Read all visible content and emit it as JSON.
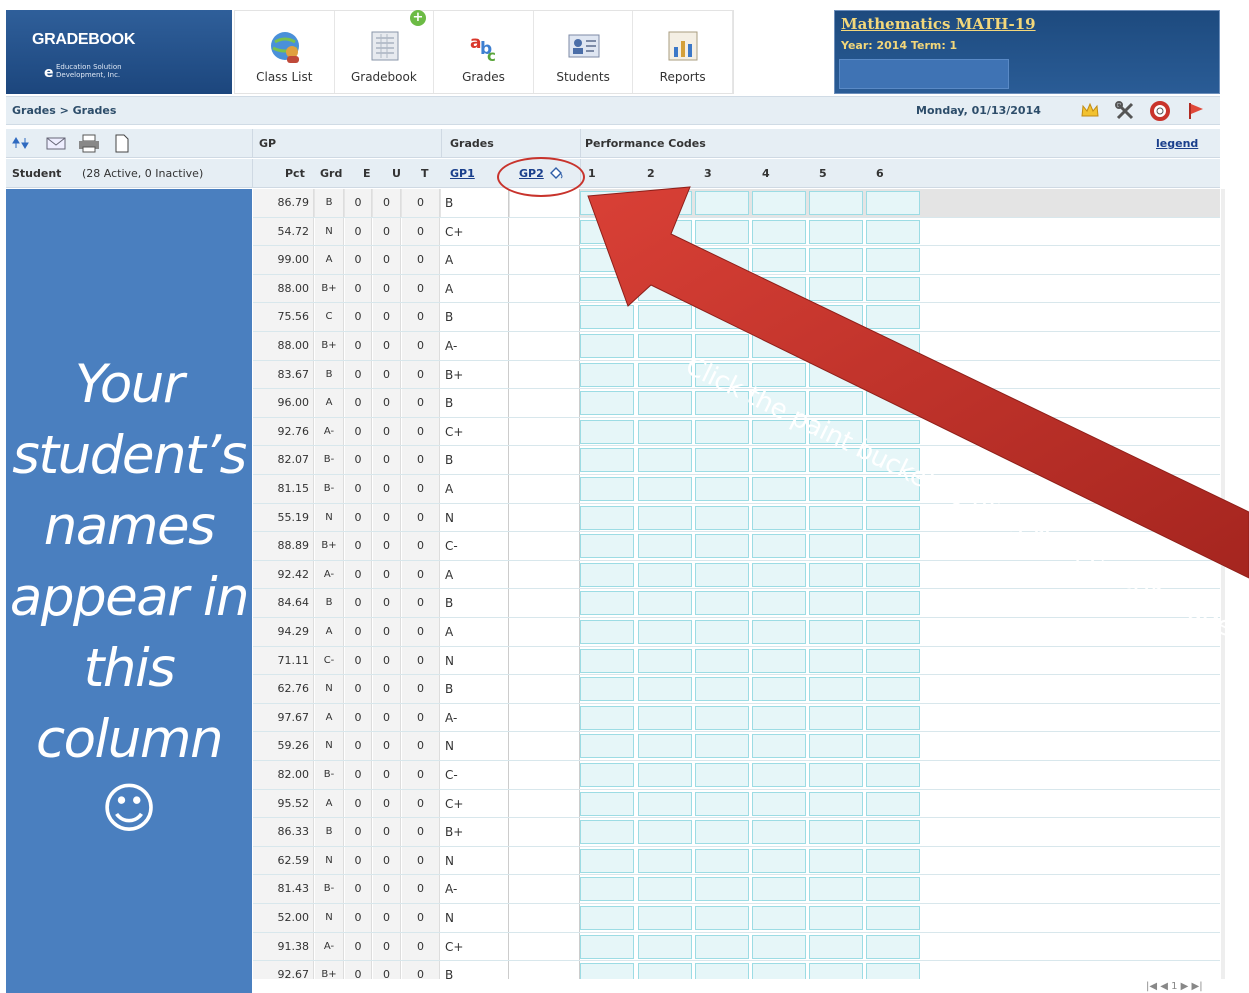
{
  "app": {
    "logo_title": "GRADEBOOK",
    "logo_sub": "Education Solution Development, Inc.",
    "nav": [
      {
        "label": "Class List",
        "icon": "globe-people-icon"
      },
      {
        "label": "Gradebook",
        "icon": "gradebook-icon"
      },
      {
        "label": "Grades",
        "icon": "grades-abc-icon"
      },
      {
        "label": "Students",
        "icon": "students-card-icon"
      },
      {
        "label": "Reports",
        "icon": "reports-chart-icon"
      }
    ],
    "course_title": "Mathematics MATH-19",
    "course_year_term": "Year: 2014 Term: 1"
  },
  "breadcrumb": "Grades > Grades",
  "date": "Monday, 01/13/2014",
  "toolbar_icons": [
    "crown-icon",
    "tools-icon",
    "help-lifebuoy-icon",
    "exit-flag-icon"
  ],
  "grid_header": {
    "gp": "GP",
    "grades": "Grades",
    "performance_codes": "Performance Codes",
    "legend": "legend",
    "student_label": "Student",
    "student_count": "(28 Active, 0 Inactive)",
    "cols": {
      "pct": "Pct",
      "grd": "Grd",
      "e": "E",
      "u": "U",
      "t": "T",
      "gp1": "GP1",
      "gp2": "GP2"
    },
    "perf_cols": [
      "1",
      "2",
      "3",
      "4",
      "5",
      "6"
    ]
  },
  "rows": [
    {
      "pct": "86.79",
      "grd": "B",
      "e": "0",
      "u": "0",
      "t": "0",
      "gp1": "B"
    },
    {
      "pct": "54.72",
      "grd": "N",
      "e": "0",
      "u": "0",
      "t": "0",
      "gp1": "C+"
    },
    {
      "pct": "99.00",
      "grd": "A",
      "e": "0",
      "u": "0",
      "t": "0",
      "gp1": "A"
    },
    {
      "pct": "88.00",
      "grd": "B+",
      "e": "0",
      "u": "0",
      "t": "0",
      "gp1": "A"
    },
    {
      "pct": "75.56",
      "grd": "C",
      "e": "0",
      "u": "0",
      "t": "0",
      "gp1": "B"
    },
    {
      "pct": "88.00",
      "grd": "B+",
      "e": "0",
      "u": "0",
      "t": "0",
      "gp1": "A-"
    },
    {
      "pct": "83.67",
      "grd": "B",
      "e": "0",
      "u": "0",
      "t": "0",
      "gp1": "B+"
    },
    {
      "pct": "96.00",
      "grd": "A",
      "e": "0",
      "u": "0",
      "t": "0",
      "gp1": "B"
    },
    {
      "pct": "92.76",
      "grd": "A-",
      "e": "0",
      "u": "0",
      "t": "0",
      "gp1": "C+"
    },
    {
      "pct": "82.07",
      "grd": "B-",
      "e": "0",
      "u": "0",
      "t": "0",
      "gp1": "B"
    },
    {
      "pct": "81.15",
      "grd": "B-",
      "e": "0",
      "u": "0",
      "t": "0",
      "gp1": "A"
    },
    {
      "pct": "55.19",
      "grd": "N",
      "e": "0",
      "u": "0",
      "t": "0",
      "gp1": "N"
    },
    {
      "pct": "88.89",
      "grd": "B+",
      "e": "0",
      "u": "0",
      "t": "0",
      "gp1": "C-"
    },
    {
      "pct": "92.42",
      "grd": "A-",
      "e": "0",
      "u": "0",
      "t": "0",
      "gp1": "A"
    },
    {
      "pct": "84.64",
      "grd": "B",
      "e": "0",
      "u": "0",
      "t": "0",
      "gp1": "B"
    },
    {
      "pct": "94.29",
      "grd": "A",
      "e": "0",
      "u": "0",
      "t": "0",
      "gp1": "A"
    },
    {
      "pct": "71.11",
      "grd": "C-",
      "e": "0",
      "u": "0",
      "t": "0",
      "gp1": "N"
    },
    {
      "pct": "62.76",
      "grd": "N",
      "e": "0",
      "u": "0",
      "t": "0",
      "gp1": "B"
    },
    {
      "pct": "97.67",
      "grd": "A",
      "e": "0",
      "u": "0",
      "t": "0",
      "gp1": "A-"
    },
    {
      "pct": "59.26",
      "grd": "N",
      "e": "0",
      "u": "0",
      "t": "0",
      "gp1": "N"
    },
    {
      "pct": "82.00",
      "grd": "B-",
      "e": "0",
      "u": "0",
      "t": "0",
      "gp1": "C-"
    },
    {
      "pct": "95.52",
      "grd": "A",
      "e": "0",
      "u": "0",
      "t": "0",
      "gp1": "C+"
    },
    {
      "pct": "86.33",
      "grd": "B",
      "e": "0",
      "u": "0",
      "t": "0",
      "gp1": "B+"
    },
    {
      "pct": "62.59",
      "grd": "N",
      "e": "0",
      "u": "0",
      "t": "0",
      "gp1": "N"
    },
    {
      "pct": "81.43",
      "grd": "B-",
      "e": "0",
      "u": "0",
      "t": "0",
      "gp1": "A-"
    },
    {
      "pct": "52.00",
      "grd": "N",
      "e": "0",
      "u": "0",
      "t": "0",
      "gp1": "N"
    },
    {
      "pct": "91.38",
      "grd": "A-",
      "e": "0",
      "u": "0",
      "t": "0",
      "gp1": "C+"
    },
    {
      "pct": "92.67",
      "grd": "B+",
      "e": "0",
      "u": "0",
      "t": "0",
      "gp1": "B"
    }
  ],
  "annotations": {
    "panel_note_lines": [
      "Your",
      "student’s",
      "names",
      "appear in",
      "this",
      "column"
    ],
    "smiley": "☺",
    "callout": "Click the paint bucket to fill in the current grades.",
    "arrow_color": "#c0322b"
  },
  "pager": "|◀ ◀ 1 ▶ ▶|",
  "colors": {
    "brand": "#1c467d",
    "accent_gold": "#f3d77a",
    "panel_blue": "#4a7fbf",
    "cell_teal": "#e6f6f8"
  }
}
